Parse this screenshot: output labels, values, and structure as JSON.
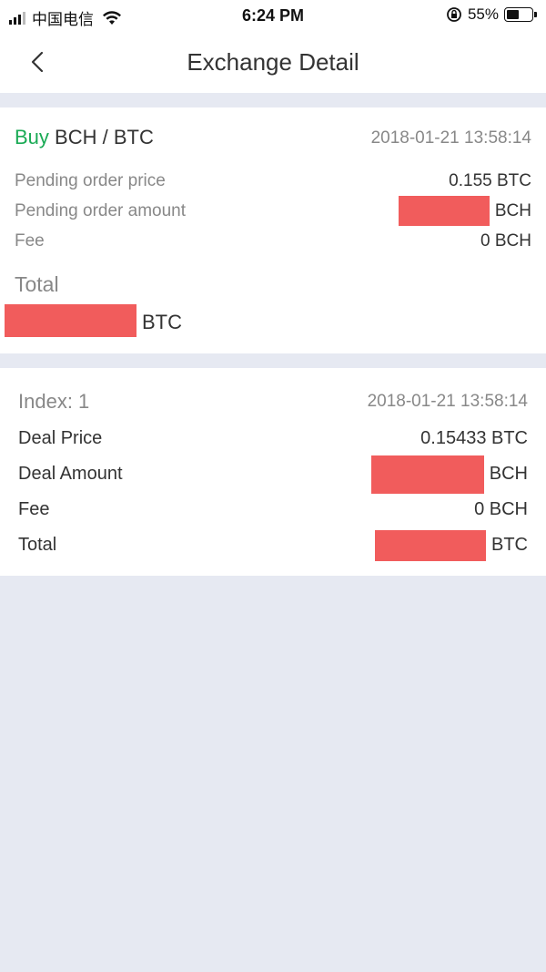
{
  "status_bar": {
    "carrier": "中国电信",
    "time": "6:24 PM",
    "battery": "55%",
    "battery_level": 0.55
  },
  "header": {
    "title": "Exchange Detail",
    "back_icon": "chevron-left-icon"
  },
  "order": {
    "side": "Buy",
    "pair": "BCH / BTC",
    "timestamp": "2018-01-21 13:58:14",
    "rows": [
      {
        "label": "Pending order price",
        "value": "0.155 BTC"
      },
      {
        "label": "Pending order amount",
        "unit": "BCH",
        "redacted": true
      },
      {
        "label": "Fee",
        "value": "0 BCH"
      }
    ],
    "total_label": "Total",
    "total_unit": "BTC",
    "total_redacted": true
  },
  "deal": {
    "index_label": "Index: 1",
    "timestamp": "2018-01-21 13:58:14",
    "rows": [
      {
        "label": "Deal Price",
        "value": "0.15433 BTC"
      },
      {
        "label": "Deal Amount",
        "unit": "BCH",
        "redacted": true
      },
      {
        "label": "Fee",
        "value": "0 BCH"
      },
      {
        "label": "Total",
        "unit": "BTC",
        "redacted": true
      }
    ]
  },
  "colors": {
    "buy": "#1aaa55",
    "redaction": "#f15c5c",
    "background": "#e6e9f2"
  }
}
